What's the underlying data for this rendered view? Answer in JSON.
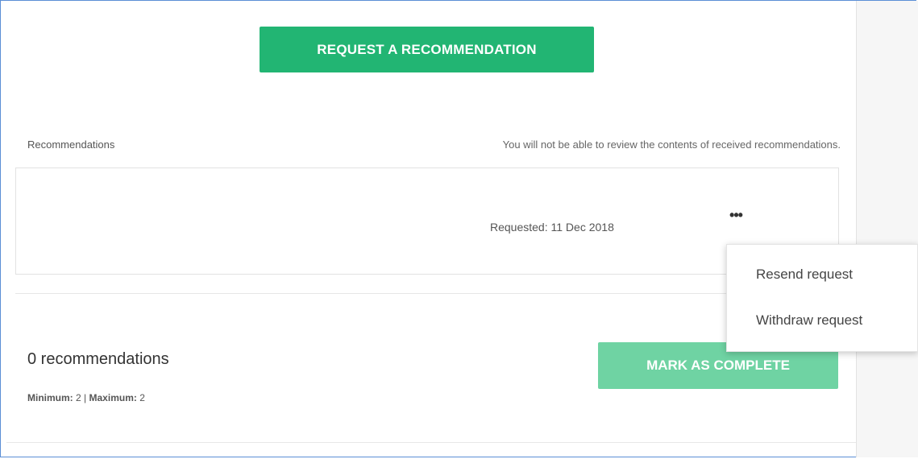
{
  "request_button": {
    "label": "REQUEST A RECOMMENDATION"
  },
  "recommendations": {
    "header_label": "Recommendations",
    "header_note": "You will not be able to review the contents of received recommendations.",
    "items": [
      {
        "requested": "Requested: 11 Dec 2018",
        "more_label": "•••"
      }
    ]
  },
  "menu": {
    "items": [
      {
        "label": "Resend request"
      },
      {
        "label": "Withdraw request"
      }
    ]
  },
  "summary": {
    "count_text": "0 recommendations",
    "minimum_label": "Minimum:",
    "minimum_value": "2",
    "separator": "|",
    "maximum_label": "Maximum:",
    "maximum_value": "2"
  },
  "complete_button": {
    "label": "MARK AS COMPLETE"
  },
  "colors": {
    "primary_green": "#22b573",
    "disabled_green": "#6fd3a3",
    "frame_border": "#5b8fd6"
  }
}
